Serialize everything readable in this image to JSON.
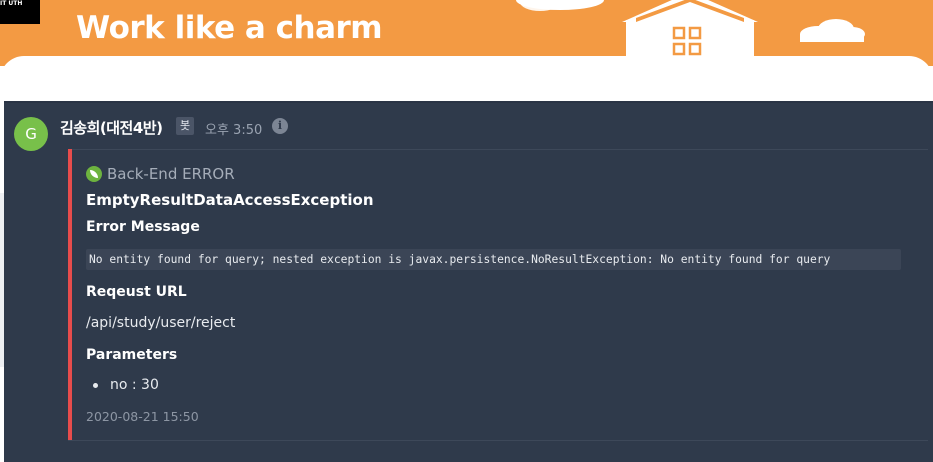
{
  "banner": {
    "title": "Work like a charm",
    "corner_text": "IT UTH",
    "color": "#f39a43"
  },
  "message": {
    "avatar_letter": "G",
    "avatar_color": "#78c04a",
    "username": "김송희(대전4반)",
    "bot_badge": "봇",
    "time": "오후 3:50",
    "info_icon": "info-icon"
  },
  "attachment": {
    "accent_color": "#e74c4c",
    "author_icon": "spring-leaf-icon",
    "author": "Back-End ERROR",
    "title": "EmptyResultDataAccessException",
    "error_message_label": "Error Message",
    "error_message": "No entity found for query; nested exception is javax.persistence.NoResultException: No entity found for query",
    "request_url_label": "Reqeust URL",
    "request_url": "/api/study/user/reject",
    "parameters_label": "Parameters",
    "parameters": [
      "no : 30"
    ],
    "footer": "2020-08-21 15:50"
  }
}
